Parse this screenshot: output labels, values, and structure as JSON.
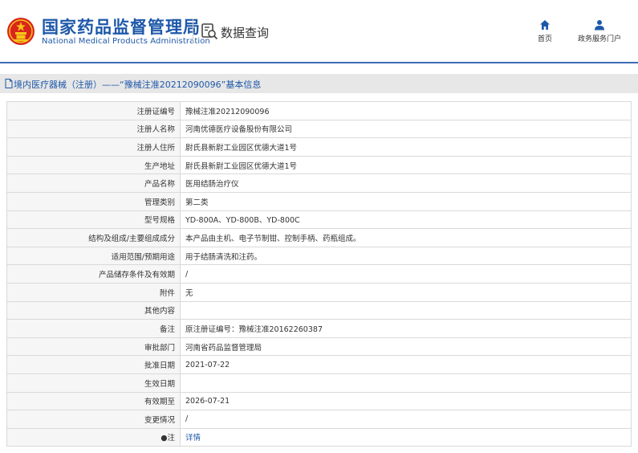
{
  "header": {
    "brand_cn": "国家药品监督管理局",
    "brand_en": "National Medical Products Administration",
    "search_title": "数据查询",
    "nav": {
      "home_label": "首页",
      "user_label": "政务服务门户"
    },
    "accent_color": "#1e58a9",
    "emblem_colors": {
      "red": "#d9251c",
      "gold": "#f5c518"
    }
  },
  "breadcrumb": {
    "text": "境内医疗器械（注册）——“豫械注准20212090096”基本信息"
  },
  "rows": [
    {
      "label": "注册证编号",
      "value": "豫械注准20212090096"
    },
    {
      "label": "注册人名称",
      "value": "河南优德医疗设备股份有限公司"
    },
    {
      "label": "注册人住所",
      "value": "尉氏县新尉工业园区优德大道1号"
    },
    {
      "label": "生产地址",
      "value": "尉氏县新尉工业园区优德大道1号"
    },
    {
      "label": "产品名称",
      "value": "医用结肠治疗仪"
    },
    {
      "label": "管理类别",
      "value": "第二类"
    },
    {
      "label": "型号规格",
      "value": "YD-800A、YD-800B、YD-800C"
    },
    {
      "label": "结构及组成/主要组成成分",
      "value": "本产品由主机、电子节制钳、控制手柄、药瓶组成。"
    },
    {
      "label": "适用范围/预期用途",
      "value": "用于结肠清洗和注药。"
    },
    {
      "label": "产品储存条件及有效期",
      "value": "/"
    },
    {
      "label": "附件",
      "value": "无"
    },
    {
      "label": "其他内容",
      "value": ""
    },
    {
      "label": "备注",
      "value": "原注册证编号：豫械注准20162260387"
    },
    {
      "label": "审批部门",
      "value": "河南省药品监督管理局"
    },
    {
      "label": "批准日期",
      "value": "2021-07-22"
    },
    {
      "label": "生效日期",
      "value": ""
    },
    {
      "label": "有效期至",
      "value": "2026-07-21"
    },
    {
      "label": "变更情况",
      "value": "/"
    },
    {
      "label": "●注",
      "value": "详情",
      "link": true
    }
  ]
}
